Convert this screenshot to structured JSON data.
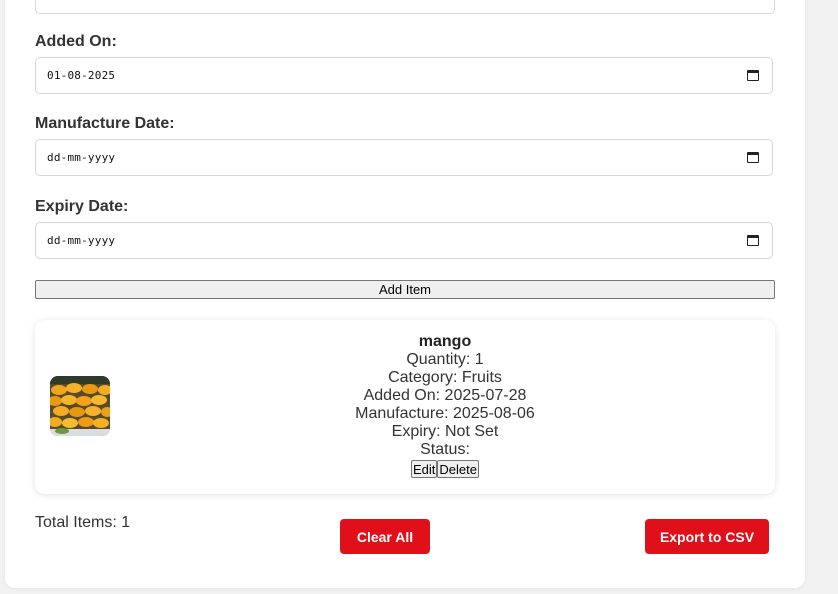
{
  "form": {
    "added_on": {
      "label": "Added On:",
      "value": "01-08-2025"
    },
    "manufacture_date": {
      "label": "Manufacture Date:",
      "value": "dd-mm-yyyy"
    },
    "expiry_date": {
      "label": "Expiry Date:",
      "value": "dd-mm-yyyy"
    },
    "add_button": "Add Item"
  },
  "item": {
    "name": "mango",
    "quantity": "Quantity: 1",
    "category": "Category: Fruits",
    "added_on": "Added On: 2025-07-28",
    "manufacture": "Manufacture: 2025-08-06",
    "expiry": "Expiry: Not Set",
    "status": "Status:",
    "edit_label": "Edit",
    "delete_label": "Delete"
  },
  "footer": {
    "total": "Total Items: 1",
    "clear_all": "Clear All",
    "export_csv": "Export to CSV"
  },
  "colors": {
    "accent_red": "#e0101b"
  },
  "icons": {
    "calendar": "calendar-icon"
  }
}
